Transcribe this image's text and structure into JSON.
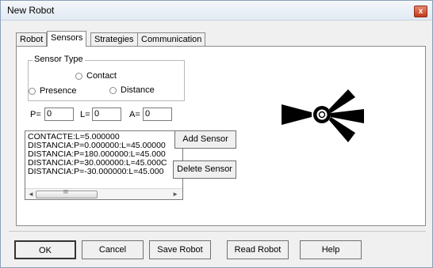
{
  "window": {
    "title": "New Robot",
    "close_symbol": "x"
  },
  "tabs": [
    {
      "label": "Robot",
      "active": false
    },
    {
      "label": "Sensors",
      "active": true
    },
    {
      "label": "Strategies",
      "active": false
    },
    {
      "label": "Communication",
      "active": false
    }
  ],
  "sensor_type": {
    "group_label": "Sensor Type",
    "options": [
      {
        "label": "Contact",
        "selected": false
      },
      {
        "label": "Presence",
        "selected": false
      },
      {
        "label": "Distance",
        "selected": false
      }
    ]
  },
  "params": {
    "p_label": "P=",
    "p_value": "0",
    "l_label": "L=",
    "l_value": "0",
    "a_label": "A=",
    "a_value": "0"
  },
  "sensor_list": [
    "CONTACTE:L=5.000000",
    "DISTANCIA:P=0.000000:L=45.00000",
    "DISTANCIA:P=180.000000:L=45.000",
    "DISTANCIA:P=30.000000:L=45.000C",
    "DISTANCIA:P=-30.000000:L=45.000"
  ],
  "buttons": {
    "add_sensor": "Add Sensor",
    "delete_sensor": "Delete Sensor",
    "ok": "OK",
    "cancel": "Cancel",
    "save_robot": "Save Robot",
    "read_robot": "Read Robot",
    "help": "Help"
  },
  "scrollbar": {
    "left": "◄",
    "right": "►",
    "grip": "III"
  },
  "colors": {
    "sensor_fill": "#000000",
    "panel": "#ffffff",
    "dialog": "#f0f0f0"
  }
}
